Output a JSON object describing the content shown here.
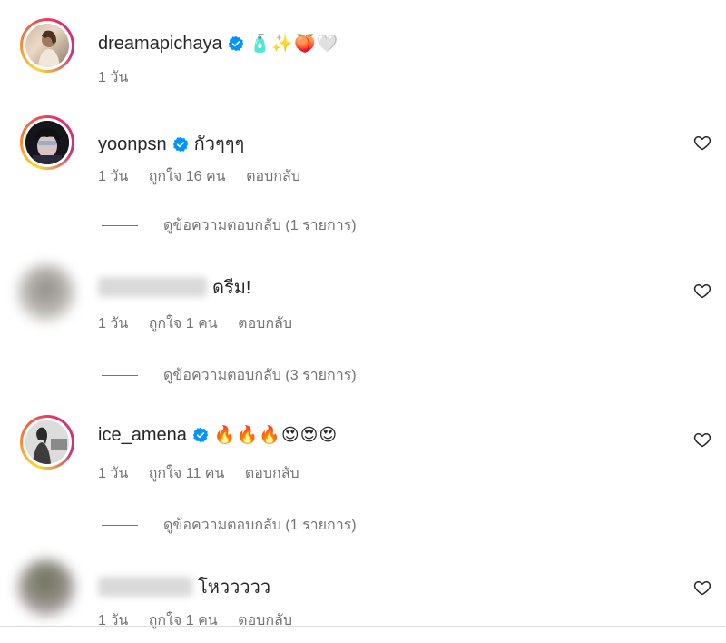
{
  "comments": [
    {
      "username": "dreamapichaya",
      "text": "",
      "emojis": "🧴✨🍑🤍",
      "time": "1 วัน",
      "likes": "",
      "reply": ""
    },
    {
      "username": "yoonpsn",
      "text": "กัวๆๆๆ",
      "time": "1 วัน",
      "likes": "ถูกใจ 16 คน",
      "reply": "ตอบกลับ",
      "view_replies": "ดูข้อความตอบกลับ (1 รายการ)"
    },
    {
      "username": "",
      "text": "ดรีม!",
      "time": "1 วัน",
      "likes": "ถูกใจ 1 คน",
      "reply": "ตอบกลับ",
      "view_replies": "ดูข้อความตอบกลับ (3 รายการ)"
    },
    {
      "username": "ice_amena",
      "text": "",
      "emojis": "🔥🔥🔥😍😍😍",
      "time": "1 วัน",
      "likes": "ถูกใจ 11 คน",
      "reply": "ตอบกลับ",
      "view_replies": "ดูข้อความตอบกลับ (1 รายการ)"
    },
    {
      "username": "",
      "text": "โหววววว",
      "time": "1 วัน",
      "likes": "ถูกใจ 1 คน",
      "reply": "ตอบกลับ"
    }
  ],
  "colors": {
    "verified": "#0095f6",
    "meta_text": "#737373",
    "primary_text": "#262626"
  }
}
